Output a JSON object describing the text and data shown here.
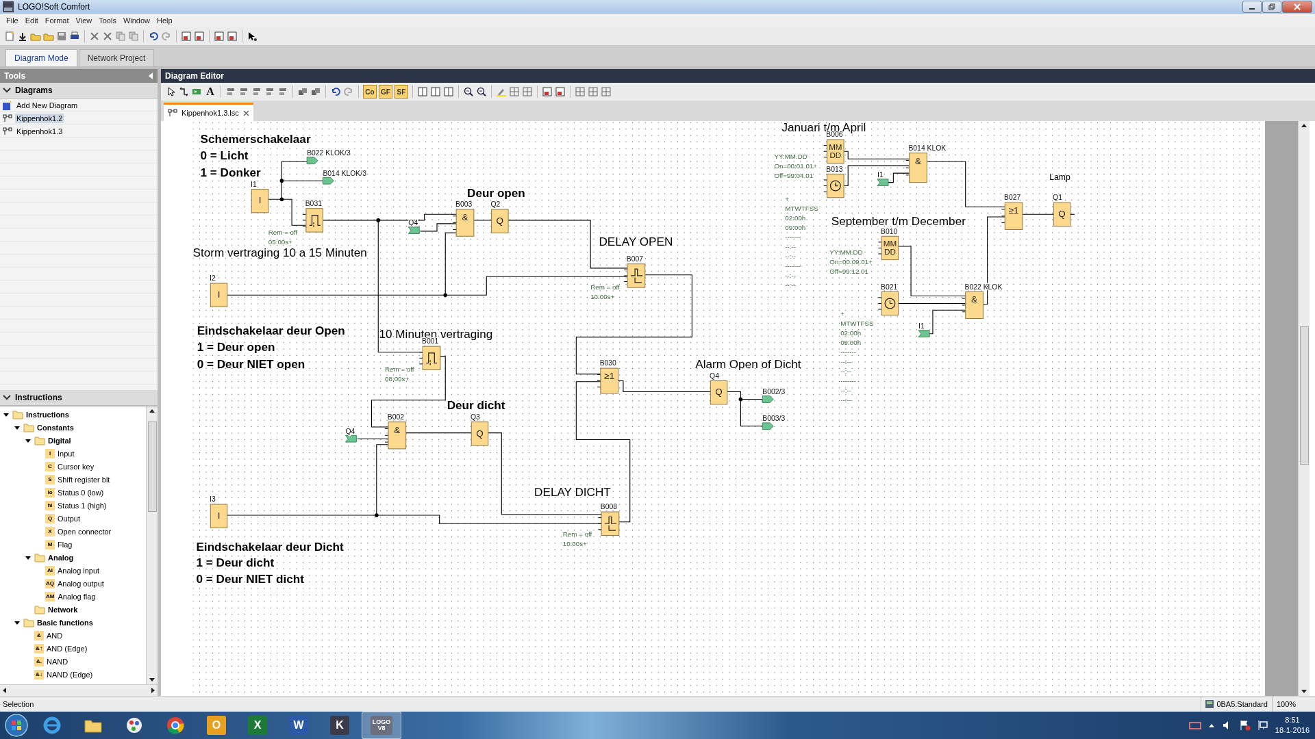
{
  "window": {
    "title": "LOGO!Soft Comfort"
  },
  "menu": [
    "File",
    "Edit",
    "Format",
    "View",
    "Tools",
    "Window",
    "Help"
  ],
  "mode_tabs": [
    {
      "label": "Diagram Mode",
      "selected": true
    },
    {
      "label": "Network Project",
      "selected": false
    }
  ],
  "tools_panel": {
    "title": "Tools",
    "diagrams_header": "Diagrams",
    "diagrams": [
      {
        "label": "Add New Diagram",
        "kind": "add",
        "selected": false
      },
      {
        "label": "Kippenhok1.2",
        "kind": "diagram",
        "selected": true
      },
      {
        "label": "Kippenhok1.3",
        "kind": "diagram",
        "selected": false
      }
    ],
    "instructions_header": "Instructions",
    "tree": [
      {
        "label": "Instructions",
        "kind": "folder",
        "expanded": true,
        "children": [
          {
            "label": "Constants",
            "kind": "folder",
            "expanded": true,
            "children": [
              {
                "label": "Digital",
                "kind": "folder",
                "expanded": true,
                "children": [
                  {
                    "label": "Input",
                    "kind": "item",
                    "badge": "I"
                  },
                  {
                    "label": "Cursor key",
                    "kind": "item",
                    "badge": "C"
                  },
                  {
                    "label": "Shift register bit",
                    "kind": "item",
                    "badge": "S"
                  },
                  {
                    "label": "Status 0 (low)",
                    "kind": "item",
                    "badge": "lo"
                  },
                  {
                    "label": "Status 1 (high)",
                    "kind": "item",
                    "badge": "hi"
                  },
                  {
                    "label": "Output",
                    "kind": "item",
                    "badge": "Q"
                  },
                  {
                    "label": "Open connector",
                    "kind": "item",
                    "badge": "X"
                  },
                  {
                    "label": "Flag",
                    "kind": "item",
                    "badge": "M"
                  }
                ]
              },
              {
                "label": "Analog",
                "kind": "folder",
                "expanded": true,
                "children": [
                  {
                    "label": "Analog input",
                    "kind": "item",
                    "badge": "AI"
                  },
                  {
                    "label": "Analog output",
                    "kind": "item",
                    "badge": "AQ"
                  },
                  {
                    "label": "Analog flag",
                    "kind": "item",
                    "badge": "AM"
                  }
                ]
              },
              {
                "label": "Network",
                "kind": "folder",
                "expanded": false
              }
            ]
          },
          {
            "label": "Basic functions",
            "kind": "folder",
            "expanded": true,
            "children": [
              {
                "label": "AND",
                "kind": "item",
                "badge": "&"
              },
              {
                "label": "AND (Edge)",
                "kind": "item",
                "badge": "&↑"
              },
              {
                "label": "NAND",
                "kind": "item",
                "badge": "&."
              },
              {
                "label": "NAND (Edge)",
                "kind": "item",
                "badge": "&↓"
              }
            ]
          }
        ]
      }
    ]
  },
  "editor": {
    "title": "Diagram Editor",
    "text_tools": [
      "A",
      "Co",
      "GF",
      "SF"
    ],
    "file_tab": {
      "label": "Kippenhok1.3.lsc",
      "selected": true
    },
    "canvas": {
      "comments": [
        {
          "text": "Schemerschakelaar",
          "kind": "comment",
          "bold": true
        },
        {
          "text": "0 = Licht",
          "kind": "comment",
          "bold": true
        },
        {
          "text": "1 = Donker",
          "kind": "comment",
          "bold": true
        },
        {
          "text": "Deur open",
          "kind": "comment",
          "bold": true
        },
        {
          "text": "Storm vertraging 10 a 15 Minuten",
          "kind": "comment",
          "bold": false
        },
        {
          "text": "DELAY OPEN",
          "kind": "comment",
          "bold": false
        },
        {
          "text": "Eindschakelaar deur Open",
          "kind": "comment",
          "bold": true
        },
        {
          "text": "1 = Deur open",
          "kind": "comment",
          "bold": true
        },
        {
          "text": "0 = Deur NIET open",
          "kind": "comment",
          "bold": true
        },
        {
          "text": "10 Minuten vertraging",
          "kind": "comment",
          "bold": false
        },
        {
          "text": "Deur dicht",
          "kind": "comment",
          "bold": true
        },
        {
          "text": "Alarm Open of Dicht",
          "kind": "comment",
          "bold": false
        },
        {
          "text": "DELAY DICHT",
          "kind": "comment",
          "bold": false
        },
        {
          "text": "Eindschakelaar deur Dicht",
          "kind": "comment",
          "bold": true
        },
        {
          "text": "1 = Deur dicht",
          "kind": "comment",
          "bold": true
        },
        {
          "text": "0 = Deur NIET dicht",
          "kind": "comment",
          "bold": true
        },
        {
          "text": "Januari t/m April",
          "kind": "comment",
          "bold": false
        },
        {
          "text": "September t/m December",
          "kind": "comment",
          "bold": false
        },
        {
          "text": "Lamp",
          "kind": "label",
          "bold": false
        }
      ],
      "blocks": [
        {
          "label": "I1",
          "kind": "input",
          "symbol": "I"
        },
        {
          "label": "B031",
          "kind": "pulse",
          "params": [
            "Rem = off",
            "05:00s+"
          ]
        },
        {
          "label": "B003",
          "kind": "and",
          "symbol": "&"
        },
        {
          "label": "Q2",
          "kind": "output",
          "symbol": "Q"
        },
        {
          "label": "I2",
          "kind": "input",
          "symbol": "I"
        },
        {
          "label": "B007",
          "kind": "on_off_delay",
          "params": [
            "Rem = off",
            "10:00s+"
          ]
        },
        {
          "label": "B001",
          "kind": "pulse",
          "params": [
            "Rem = off",
            "08:00s+"
          ]
        },
        {
          "label": "B030",
          "kind": "or",
          "symbol": "≥1"
        },
        {
          "label": "Q4",
          "kind": "output",
          "symbol": "Q"
        },
        {
          "label": "B002",
          "kind": "and",
          "symbol": "&"
        },
        {
          "label": "Q3",
          "kind": "output",
          "symbol": "Q"
        },
        {
          "label": "I3",
          "kind": "input",
          "symbol": "I"
        },
        {
          "label": "B008",
          "kind": "on_off_delay",
          "params": [
            "Rem = off",
            "10:00s+"
          ]
        },
        {
          "label": "B006",
          "kind": "date",
          "symbol": "MM DD",
          "params": [
            "YY:MM.DD",
            "On=00:01.01+",
            "Off=99:04.01"
          ]
        },
        {
          "label": "B013",
          "kind": "clock",
          "params": [
            "+",
            "MTWTFSS",
            "02:00h",
            "09:00h",
            "-------",
            "--:--",
            "--:--",
            "-------",
            "--:--",
            "--:--"
          ]
        },
        {
          "label": "B014 KLOK",
          "kind": "and",
          "symbol": "&"
        },
        {
          "label": "B027",
          "kind": "or",
          "symbol": "≥1"
        },
        {
          "label": "Q1",
          "kind": "output",
          "symbol": "Q"
        },
        {
          "label": "B010",
          "kind": "date",
          "symbol": "MM DD",
          "params": [
            "YY:MM.DD",
            "On=00:09.01+",
            "Off=99:12.01"
          ]
        },
        {
          "label": "B021",
          "kind": "clock",
          "params": [
            "+",
            "MTWTFSS",
            "02:00h",
            "09:00h",
            "-------",
            "--:--",
            "--:--",
            "-------",
            "--:--",
            "--:--"
          ]
        },
        {
          "label": "B022 KLOK",
          "kind": "and",
          "symbol": "&"
        }
      ],
      "connectors": [
        {
          "label": "B022 KLOK/3",
          "kind": "out"
        },
        {
          "label": "B014 KLOK/3",
          "kind": "out"
        },
        {
          "label": "Q4",
          "kind": "in"
        },
        {
          "label": "I1",
          "kind": "in"
        },
        {
          "label": "I1",
          "kind": "in"
        },
        {
          "label": "B002/3",
          "kind": "out"
        },
        {
          "label": "B003/3",
          "kind": "out"
        },
        {
          "label": "Q4",
          "kind": "in"
        }
      ]
    }
  },
  "status_bar": {
    "text": "Selection",
    "device": "0BA5.Standard",
    "zoom": "100%"
  },
  "taskbar": {
    "apps": [
      {
        "kind": "ie",
        "selected": false
      },
      {
        "kind": "explorer",
        "selected": false
      },
      {
        "kind": "paint",
        "selected": false
      },
      {
        "kind": "chrome",
        "selected": false
      },
      {
        "kind": "letter",
        "glyph": "O",
        "color": "#e8a020",
        "selected": false
      },
      {
        "kind": "letter",
        "glyph": "X",
        "color": "#1f7a3a",
        "selected": false
      },
      {
        "kind": "letter",
        "glyph": "W",
        "color": "#2a5aa8",
        "selected": false
      },
      {
        "kind": "letter",
        "glyph": "K",
        "color": "#3a3a4a",
        "selected": false
      },
      {
        "kind": "letter",
        "glyph": "LOGO V8",
        "color": "#6a7080",
        "selected": true
      }
    ],
    "time": "8:51",
    "date": "18-1-2016"
  }
}
